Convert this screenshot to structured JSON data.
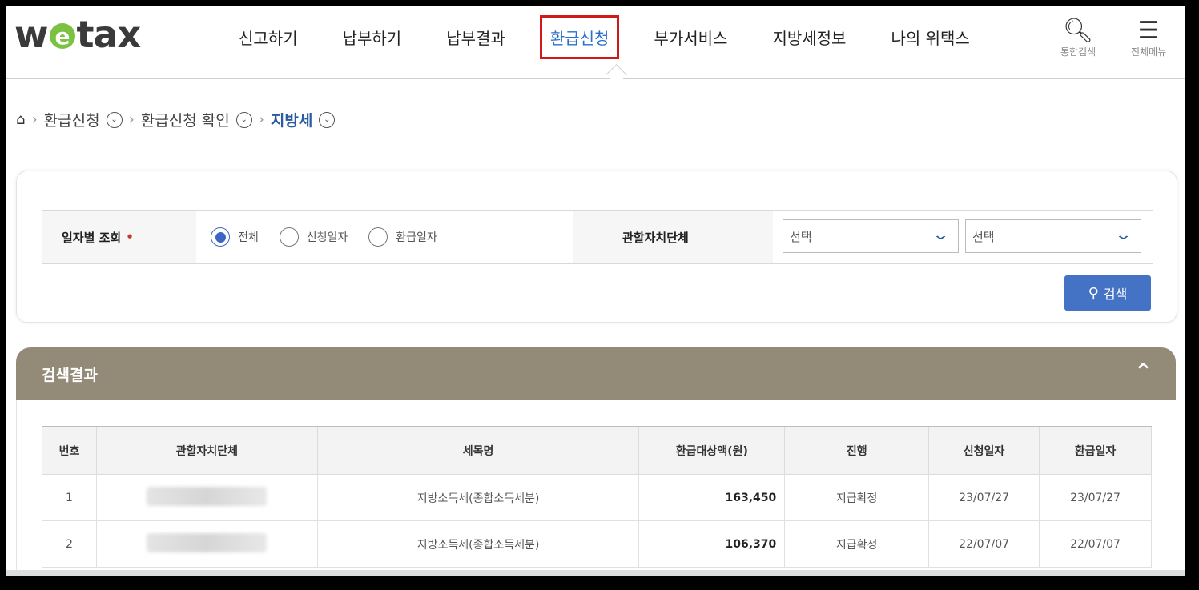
{
  "header": {
    "logo": {
      "pre": "w",
      "e": "e",
      "post": "tax"
    },
    "nav": [
      "신고하기",
      "납부하기",
      "납부결과",
      "환급신청",
      "부가서비스",
      "지방세정보",
      "나의 위택스"
    ],
    "tools": {
      "search": "통합검색",
      "menu": "전체메뉴"
    }
  },
  "breadcrumb": {
    "items": [
      "환급신청",
      "환급신청 확인",
      "지방세"
    ]
  },
  "search": {
    "date_label": "일자별 조회",
    "required_mark": "•",
    "radios": [
      "전체",
      "신청일자",
      "환급일자"
    ],
    "selected_radio": "전체",
    "region_label": "관할자치단체",
    "select1": "선택",
    "select2": "선택",
    "search_button": "검색"
  },
  "results": {
    "title": "검색결과",
    "columns": [
      "번호",
      "관할자치단체",
      "세목명",
      "환급대상액(원)",
      "진행",
      "신청일자",
      "환급일자"
    ],
    "rows": [
      {
        "no": "1",
        "region": "",
        "tax": "지방소득세(종합소득세분)",
        "amount": "163,450",
        "status": "지급확정",
        "applied": "23/07/27",
        "refunded": "23/07/27"
      },
      {
        "no": "2",
        "region": "",
        "tax": "지방소득세(종합소득세분)",
        "amount": "106,370",
        "status": "지급확정",
        "applied": "22/07/07",
        "refunded": "22/07/07"
      }
    ]
  },
  "colors": {
    "accent": "#4472c4",
    "highlight": "#d01919",
    "result_header": "#938a78",
    "logo_e": "#7cc242"
  }
}
